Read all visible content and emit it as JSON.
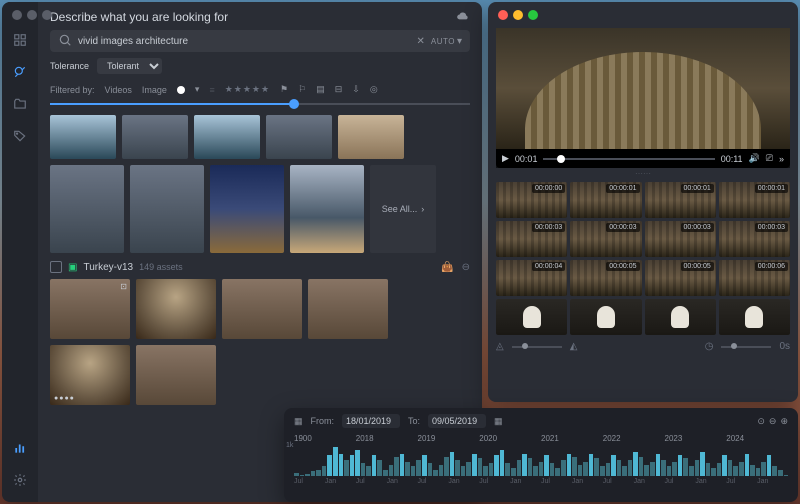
{
  "main": {
    "title": "Describe what you are looking for",
    "search": {
      "query": "vivid images architecture",
      "auto_label": "AUTO"
    },
    "tolerance": {
      "label": "Tolerance",
      "value": "Tolerant"
    },
    "filters": {
      "label": "Filtered by:",
      "chips": [
        "Videos",
        "Image"
      ]
    },
    "stars_empty": "★★★★★",
    "section": {
      "name": "Turkey-v13",
      "count": "149 assets"
    },
    "see_all": "See All..."
  },
  "preview": {
    "current_time": "00:01",
    "total_time": "00:11",
    "frames": [
      {
        "tc": "00:00:00",
        "type": "columns"
      },
      {
        "tc": "00:00:01",
        "type": "columns"
      },
      {
        "tc": "00:00:01",
        "type": "columns"
      },
      {
        "tc": "00:00:01",
        "type": "columns"
      },
      {
        "tc": "00:00:03",
        "type": "columns"
      },
      {
        "tc": "00:00:03",
        "type": "columns"
      },
      {
        "tc": "00:00:03",
        "type": "columns"
      },
      {
        "tc": "00:00:03",
        "type": "columns"
      },
      {
        "tc": "00:00:04",
        "type": "columns"
      },
      {
        "tc": "00:00:05",
        "type": "columns"
      },
      {
        "tc": "00:00:05",
        "type": "columns"
      },
      {
        "tc": "00:00:06",
        "type": "columns"
      },
      {
        "tc": "",
        "type": "figure"
      },
      {
        "tc": "",
        "type": "figure"
      },
      {
        "tc": "",
        "type": "figure"
      },
      {
        "tc": "",
        "type": "figure"
      }
    ],
    "duration_label": "0s"
  },
  "timeline": {
    "from_label": "From:",
    "from": "18/01/2019",
    "to_label": "To:",
    "to": "09/05/2019",
    "ymax_label": "1k",
    "years": [
      "1900",
      "2018",
      "2019",
      "2020",
      "2021",
      "2022",
      "2023",
      "2024"
    ]
  },
  "chart_data": {
    "type": "bar",
    "title": "",
    "xlabel": "",
    "ylabel": "",
    "ylim": [
      0,
      1000
    ],
    "x_range": [
      "1900",
      "2024"
    ],
    "major_ticks": [
      "1900",
      "2018",
      "2019",
      "2020",
      "2021",
      "2022",
      "2023",
      "2024"
    ],
    "minor_tick_pattern": [
      "Jul",
      "Jan"
    ],
    "note": "Histogram of asset counts over time. ~90 monthly bins rendered; values below estimated from visual height against y-max 1k.",
    "values": [
      80,
      20,
      50,
      150,
      200,
      300,
      650,
      900,
      700,
      500,
      650,
      800,
      400,
      300,
      650,
      500,
      200,
      350,
      600,
      700,
      450,
      300,
      500,
      650,
      400,
      200,
      350,
      600,
      750,
      500,
      300,
      450,
      700,
      550,
      300,
      400,
      650,
      800,
      400,
      250,
      500,
      700,
      550,
      300,
      450,
      650,
      400,
      250,
      500,
      700,
      600,
      350,
      450,
      700,
      550,
      300,
      400,
      650,
      500,
      300,
      500,
      750,
      600,
      350,
      450,
      700,
      500,
      300,
      450,
      650,
      550,
      300,
      500,
      750,
      400,
      250,
      400,
      650,
      500,
      300,
      450,
      700,
      350,
      250,
      450,
      650,
      300,
      200,
      30
    ]
  }
}
